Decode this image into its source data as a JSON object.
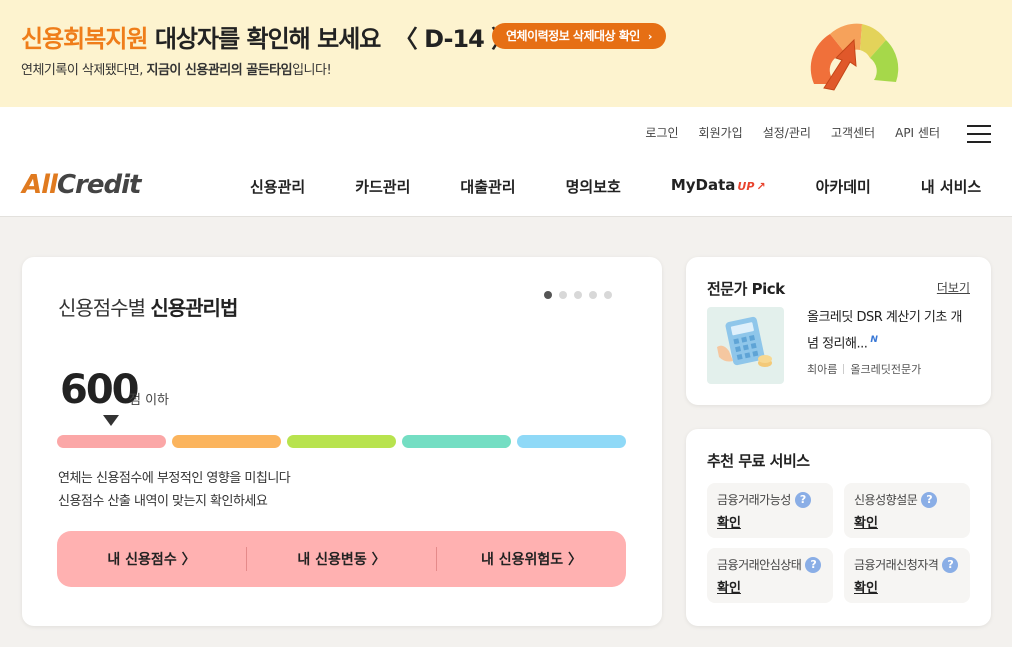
{
  "banner": {
    "title_highlight": "신용회복지원",
    "title_rest": "대상자를 확인해 보세요",
    "dday": "〈 D-14 〉",
    "button_label": "연체이력정보 삭제대상 확인",
    "sub_prefix": "연체기록이 삭제됐다면, ",
    "sub_bold": "지금이 신용관리의 골든타임",
    "sub_suffix": "입니다!"
  },
  "util_nav": [
    "로그인",
    "회원가입",
    "설정/관리",
    "고객센터",
    "API 센터"
  ],
  "logo": {
    "part1": "All",
    "part2": "Credit"
  },
  "main_nav": [
    "신용관리",
    "카드관리",
    "대출관리",
    "명의보호",
    "MyData",
    "아카데미",
    "내 서비스"
  ],
  "mydata_badge": "UP",
  "score_card": {
    "title_light": "신용점수별 ",
    "title_bold": "신용관리법",
    "slide_count": 5,
    "active_slide": 0,
    "score": "600",
    "score_unit": "점 이하",
    "bar_colors": [
      "#fba7a7",
      "#fbb45d",
      "#b8e34e",
      "#74dec3",
      "#8fd9f7"
    ],
    "desc_line1": "연체는 신용점수에 부정적인 영향을 미칩니다",
    "desc_line2": "신용점수 산출 내역이 맞는지 확인하세요",
    "actions": [
      "내 신용점수 〉",
      "내 신용변동 〉",
      "내 신용위험도 〉"
    ]
  },
  "expert_pick": {
    "title": "전문가 Pick",
    "more": "더보기",
    "article_title": "올크레딧 DSR 계산기 기초 개념 정리해...",
    "new_badge": "N",
    "author": "최아름",
    "author_role": "올크레딧전문가"
  },
  "free_services": {
    "title": "추천 무료 서비스",
    "items": [
      {
        "name": "금융거래가능성",
        "link": "확인"
      },
      {
        "name": "신용성향설문",
        "link": "확인"
      },
      {
        "name": "금융거래안심상태",
        "link": "확인"
      },
      {
        "name": "금융거래신청자격",
        "link": "확인"
      }
    ]
  },
  "colors": {
    "accent": "#ef7d1a",
    "button": "#e66f14",
    "banner_bg": "#fdf3cf",
    "action_bar": "#ffb1b1"
  }
}
